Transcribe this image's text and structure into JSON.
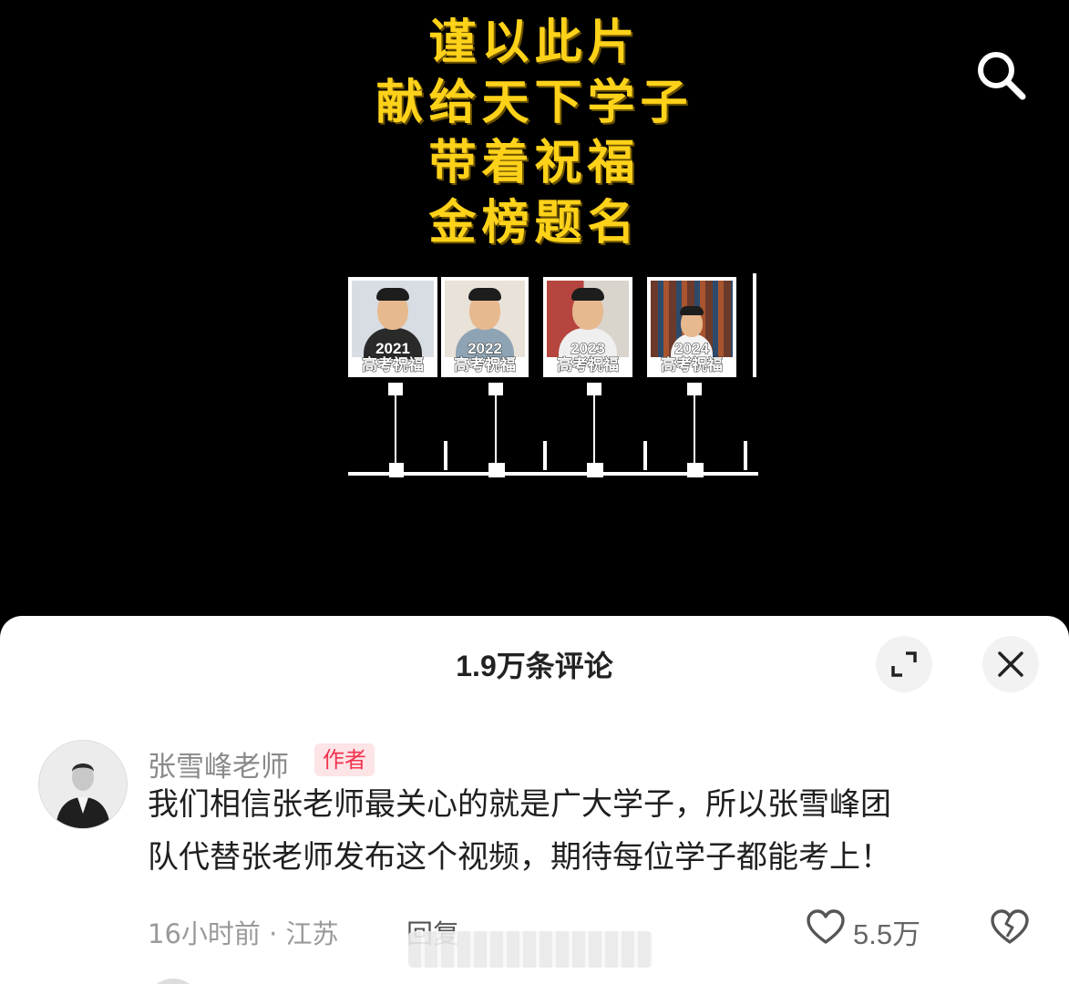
{
  "video": {
    "title_lines": [
      "谨以此片",
      "献给天下学子",
      "带着祝福",
      "金榜题名"
    ],
    "thumbnails": [
      {
        "year": "2021",
        "caption": "高考祝福"
      },
      {
        "year": "2022",
        "caption": "高考祝福"
      },
      {
        "year": "2023",
        "caption": "高考祝福"
      },
      {
        "year": "2024",
        "caption": "高考祝福"
      }
    ],
    "search_icon": "search-icon"
  },
  "comments_panel": {
    "title": "1.9万条评论",
    "expand_icon": "expand-icon",
    "close_icon": "close-icon",
    "comment": {
      "author": "张雪峰老师",
      "badge": "作者",
      "lines": [
        "我们相信张老师最关心的就是广大学子，所以张雪峰团",
        "队代替张老师发布这个视频，期待每位学子都能考上！"
      ],
      "meta": "16小时前 · 江苏",
      "reply_label": "回复",
      "likes": "5.5万",
      "like_icon": "heart-icon",
      "dislike_icon": "broken-heart-icon"
    }
  },
  "colors": {
    "title_yellow": "#ffd21a",
    "badge_text": "#f0334f",
    "badge_bg": "#fde4e6"
  }
}
